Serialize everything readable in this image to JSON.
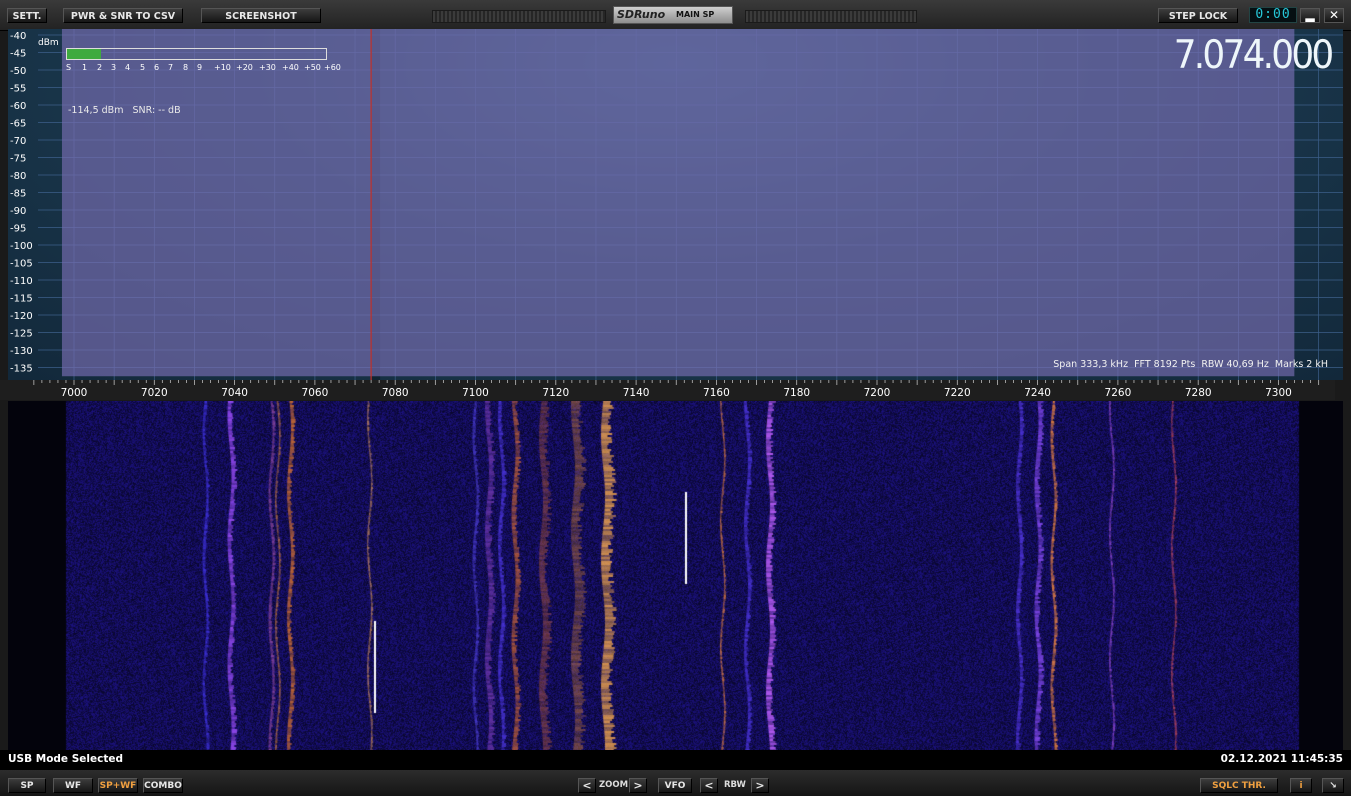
{
  "titlebar": {
    "sett_label": "SETT.",
    "csv_label": "PWR & SNR TO CSV",
    "screenshot_label": "SCREENSHOT",
    "brand_logo": "SDRuno",
    "brand_sub": "MAIN SP",
    "steplock_label": "STEP LOCK",
    "clock": "0:00",
    "minimize_label": "▂",
    "close_label": "✕"
  },
  "spectrum": {
    "dbm_label": "dBm",
    "y_ticks": [
      "-40",
      "-45",
      "-50",
      "-55",
      "-60",
      "-65",
      "-70",
      "-75",
      "-80",
      "-85",
      "-90",
      "-95",
      "-100",
      "-105",
      "-110",
      "-115",
      "-120",
      "-125",
      "-130",
      "-135"
    ],
    "x_ticks": [
      "7000",
      "7020",
      "7040",
      "7060",
      "7080",
      "7100",
      "7120",
      "7140",
      "7160",
      "7180",
      "7200",
      "7220",
      "7240",
      "7260",
      "7280",
      "7300"
    ],
    "smeter_scale": [
      "S",
      "1",
      "2",
      "3",
      "4",
      "5",
      "6",
      "7",
      "8",
      "9",
      "+10",
      "+20",
      "+30",
      "+40",
      "+50",
      "+60"
    ],
    "smeter_level_fraction": 0.13,
    "level_readout": "-114,5 dBm   SNR: -- dB",
    "frequency": "7.074.000",
    "info": "Span 333,3 kHz  FFT 8192 Pts  RBW 40,69 Hz  Marks 2 kH",
    "vfo_khz": 7074,
    "colors": {
      "fill": "#7a6fb3",
      "trace": "#ffffff",
      "vfo_line": "#c0302a",
      "grid": "#3d5f8a"
    }
  },
  "status": {
    "mode": "USB Mode Selected",
    "datetime": "02.12.2021 11:45:35"
  },
  "bottombar": {
    "sp": "SP",
    "wf": "WF",
    "spwf": "SP+WF",
    "combo": "COMBO",
    "zoom_left": "<",
    "zoom_label": "ZOOM",
    "zoom_right": ">",
    "vfo": "VFO",
    "rbw_left": "<",
    "rbw_label": "RBW",
    "rbw_right": ">",
    "sqlc": "SQLC THR.",
    "info_btn": "i",
    "resize": "↘"
  }
}
